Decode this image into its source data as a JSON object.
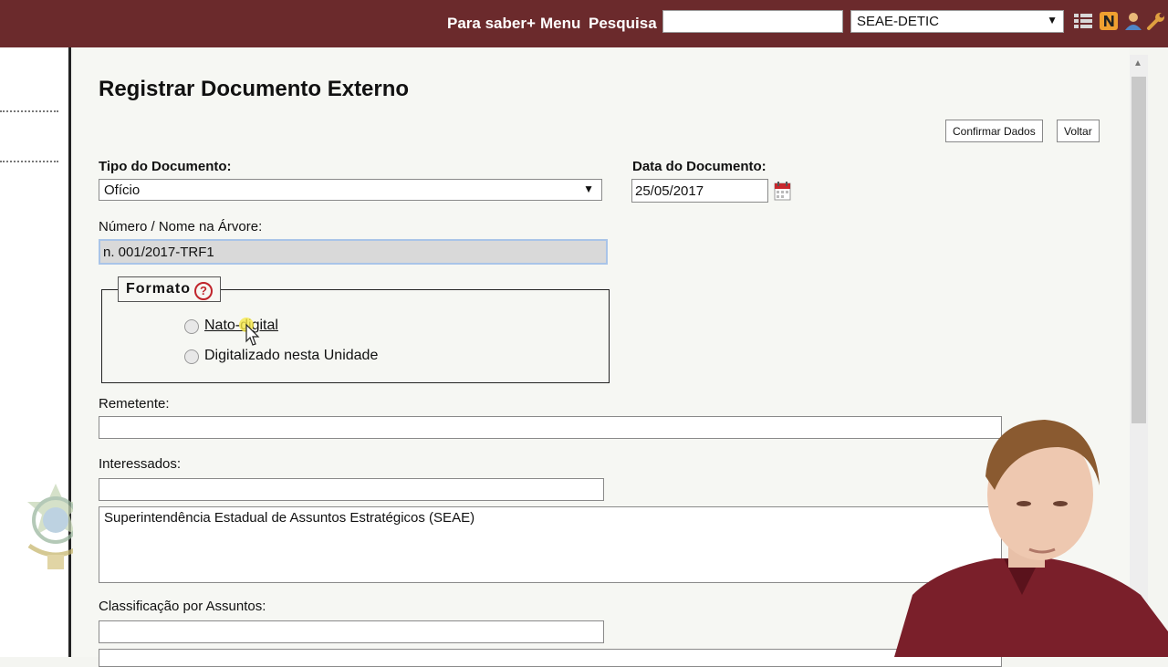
{
  "topbar": {
    "links": [
      "Para saber+",
      "Menu",
      "Pesquisa"
    ],
    "search_value": "",
    "unit_selected": "SEAE-DETIC",
    "icons": [
      "grid-icon",
      "notes-n-icon",
      "user-icon",
      "wrench-icon"
    ]
  },
  "page": {
    "title": "Registrar Documento Externo",
    "buttons": {
      "confirm": "Confirmar Dados",
      "back": "Voltar"
    }
  },
  "form": {
    "tipo_label": "Tipo do Documento:",
    "tipo_value": "Ofício",
    "data_label": "Data do Documento:",
    "data_value": "25/05/2017",
    "numero_label": "Número / Nome na Árvore:",
    "numero_value": "n. 001/2017-TRF1",
    "formato_legend": "Formato",
    "formato_options": [
      "Nato-digital",
      "Digitalizado nesta Unidade"
    ],
    "remetente_label": "Remetente:",
    "remetente_value": "",
    "interessados_label": "Interessados:",
    "interessados_input": "",
    "interessados_list": "Superintendência Estadual de Assuntos Estratégicos (SEAE)",
    "classificacao_label": "Classificação por Assuntos:",
    "classificacao_value": ""
  },
  "colors": {
    "topbar": "#6b2a2c",
    "help_icon": "#c0242b",
    "focus_border": "#a9c4e8"
  }
}
